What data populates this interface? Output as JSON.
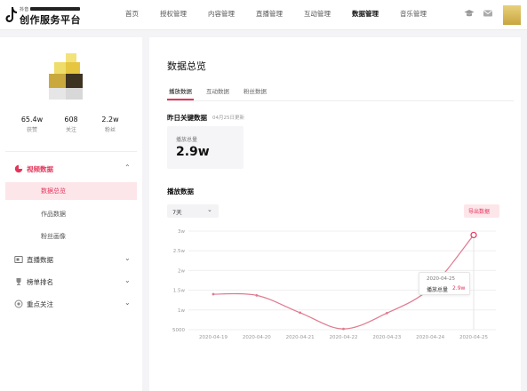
{
  "brand": {
    "small_text": "抖音",
    "name": "创作服务平台"
  },
  "nav": {
    "items": [
      {
        "label": "首页",
        "active": false
      },
      {
        "label": "授权管理",
        "active": false
      },
      {
        "label": "内容管理",
        "active": false
      },
      {
        "label": "直播管理",
        "active": false
      },
      {
        "label": "互动管理",
        "active": false
      },
      {
        "label": "数据管理",
        "active": true
      },
      {
        "label": "音乐管理",
        "active": false
      }
    ],
    "icons": [
      "graduation-cap-icon",
      "mail-icon"
    ]
  },
  "profile": {
    "stats": [
      {
        "value": "65.4w",
        "label": "获赞"
      },
      {
        "value": "608",
        "label": "关注"
      },
      {
        "value": "2.2w",
        "label": "粉丝"
      }
    ]
  },
  "sidebar": {
    "groups": [
      {
        "label": "视频数据",
        "icon": "pie-chart-icon",
        "expanded": true,
        "active": true
      },
      {
        "label": "直播数据",
        "icon": "live-screen-icon",
        "expanded": false,
        "active": false
      },
      {
        "label": "榜单排名",
        "icon": "trophy-icon",
        "expanded": false,
        "active": false
      },
      {
        "label": "重点关注",
        "icon": "target-icon",
        "expanded": false,
        "active": false
      }
    ],
    "sub_items": [
      {
        "label": "数据总览",
        "active": true
      },
      {
        "label": "作品数据",
        "active": false
      },
      {
        "label": "粉丝画像",
        "active": false
      }
    ]
  },
  "main": {
    "title": "数据总览",
    "tabs": [
      {
        "label": "播放数据",
        "active": true
      },
      {
        "label": "互动数据",
        "active": false
      },
      {
        "label": "粉丝数据",
        "active": false
      }
    ],
    "yesterday": {
      "heading": "昨日关键数据",
      "updated": "04月25日更新",
      "kpi_label": "播放总量",
      "kpi_value": "2.9w"
    },
    "chart_section": {
      "heading": "播放数据",
      "range_select": "7天",
      "export_label": "导出数据"
    },
    "tooltip": {
      "date": "2020-04-25",
      "label": "播放总量",
      "value": "2.9w"
    }
  },
  "colors": {
    "accent": "#e3365c",
    "line": "#e07a90",
    "active_bg": "#fde6ea"
  },
  "chart_data": {
    "type": "line",
    "x": [
      "2020-04-19",
      "2020-04-20",
      "2020-04-21",
      "2020-04-22",
      "2020-04-23",
      "2020-04-24",
      "2020-04-25"
    ],
    "series": [
      {
        "values": [
          14000,
          13700,
          9300,
          5200,
          9200,
          15500,
          29000
        ]
      }
    ],
    "y_ticks": [
      {
        "value": 5000,
        "label": "5000"
      },
      {
        "value": 10000,
        "label": "1w"
      },
      {
        "value": 15000,
        "label": "1.5w"
      },
      {
        "value": 20000,
        "label": "2w"
      },
      {
        "value": 25000,
        "label": "2.5w"
      },
      {
        "value": 30000,
        "label": "3w"
      }
    ],
    "ylim": [
      5000,
      30000
    ],
    "grid": true,
    "highlight_index": 6
  }
}
